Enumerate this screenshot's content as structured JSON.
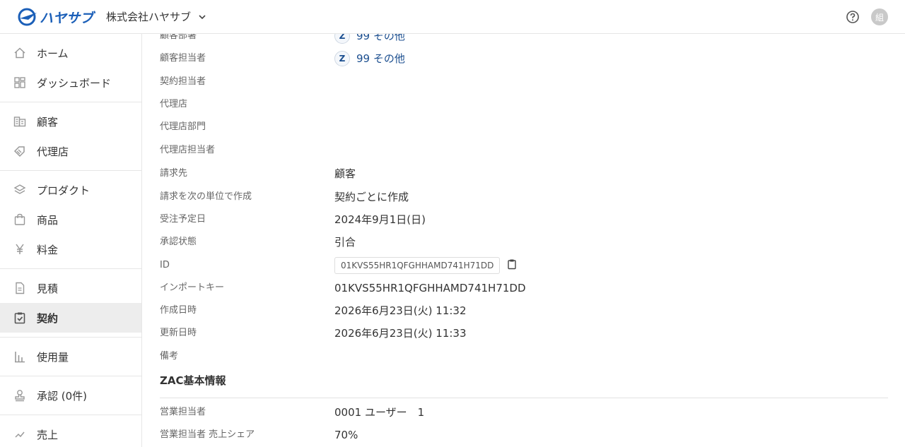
{
  "header": {
    "logo_text": "ハヤサブ",
    "company": "株式会社ハヤサブ",
    "avatar": "組",
    "brand_color": "#1b5fb8"
  },
  "sidebar": {
    "groups": [
      [
        {
          "label": "ホーム",
          "icon": "home-icon"
        },
        {
          "label": "ダッシュボード",
          "icon": "dashboard-icon"
        }
      ],
      [
        {
          "label": "顧客",
          "icon": "customer-icon"
        },
        {
          "label": "代理店",
          "icon": "agency-icon"
        }
      ],
      [
        {
          "label": "プロダクト",
          "icon": "layers-icon"
        },
        {
          "label": "商品",
          "icon": "shopping-bag-icon"
        },
        {
          "label": "料金",
          "icon": "yen-icon"
        }
      ],
      [
        {
          "label": "見積",
          "icon": "document-icon"
        },
        {
          "label": "契約",
          "icon": "clipboard-check-icon",
          "active": true
        }
      ],
      [
        {
          "label": "使用量",
          "icon": "bar-chart-icon"
        }
      ],
      [
        {
          "label": "承認 (0件)",
          "icon": "stamp-icon"
        }
      ],
      [
        {
          "label": "売上",
          "icon": "sales-icon"
        }
      ]
    ]
  },
  "fields": [
    {
      "label": "顧客部署",
      "value": "99 その他",
      "badge": "Z",
      "link": true
    },
    {
      "label": "顧客担当者",
      "value": "99 その他",
      "badge": "Z",
      "link": true
    },
    {
      "label": "契約担当者",
      "value": ""
    },
    {
      "label": "代理店",
      "value": ""
    },
    {
      "label": "代理店部門",
      "value": ""
    },
    {
      "label": "代理店担当者",
      "value": ""
    },
    {
      "label": "請求先",
      "value": "顧客"
    },
    {
      "label": "請求を次の単位で作成",
      "value": "契約ごとに作成"
    },
    {
      "label": "受注予定日",
      "value": "2024年9月1日(日)"
    },
    {
      "label": "承認状態",
      "value": "引合"
    },
    {
      "label": "ID",
      "value": "01KVS55HR1QFGHHAMD741H71DD",
      "boxed": true
    },
    {
      "label": "インポートキー",
      "value": "01KVS55HR1QFGHHAMD741H71DD"
    },
    {
      "label": "作成日時",
      "value": "2026年6月23日(火) 11:32"
    },
    {
      "label": "更新日時",
      "value": "2026年6月23日(火) 11:33"
    },
    {
      "label": "備考",
      "value": ""
    }
  ],
  "zac": {
    "title": "ZAC基本情報",
    "fields": [
      {
        "label": "営業担当者",
        "value": "0001 ユーザー　1"
      },
      {
        "label": "営業担当者 売上シェア",
        "value": "70%"
      }
    ]
  }
}
